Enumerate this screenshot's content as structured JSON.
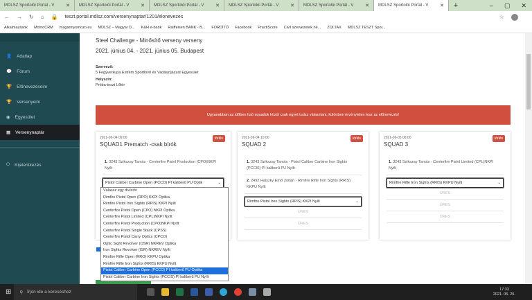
{
  "browser": {
    "tabs": [
      "MDLSZ Sportolói Portál - V",
      "MDLSZ Sportolói Portál - V",
      "MDLSZ Sportolói Portál - V",
      "MDLSZ Sportolói Portál - V",
      "MDLSZ Sportolói Portál - V",
      "MDLSZ Sportolói Portál - V"
    ],
    "url": "teszt.portal.mdlsz.com/versenynaptar/1201/elonevezes",
    "bookmarks": [
      "Alkalmazások",
      "MomoCRM",
      "magannyomozo.eu",
      "MDLSZ – Magyar D...",
      "K&H e-bank",
      "Raiffeisen BANK - B...",
      "FORDÍTÓ",
      "Facebook",
      "PractiScore",
      "Civil szervezetek né...",
      "ZOLTAX",
      "MDLSZ TESZT Spor..."
    ]
  },
  "sidebar": {
    "items": [
      "Adatlap",
      "Fórum",
      "Előnevezéseim",
      "Versenyeim",
      "Egyesület",
      "Versenynaptár"
    ],
    "logout": "Kijelentkezés"
  },
  "event": {
    "title": "Steel Challenge - Minősítő verseny verseny",
    "dates": "2021. június 04. - 2021. június 05. Budapest",
    "organizer_label": "Szervező:",
    "organizer": "5 Fegyverkupa Extrém Sportlövő és Vadászíjászat Egyesület",
    "venue_label": "Helyszín:",
    "venue": "Próba-teszt Lőtér"
  },
  "alert": "Ugyanabban az időben futó squadok közül csak egyet tudsz választani, különben érvénytelen lesz az előnevezés!",
  "squads": [
    {
      "date": "2021-06-04 09:00",
      "name": "SQUAD1 Prematch -csak bírók",
      "delete": "törlés",
      "entries": [
        {
          "num": "1.",
          "text": "3243 Szikszay Tamás - Centerfire Pistol Production (CPO)NKPI Nyílt"
        }
      ],
      "select": "Pistol Caliber Carbine Open (PCCO) PI kaliberű PU Optik",
      "empty": []
    },
    {
      "date": "2021-06-04 10:00",
      "name": "SQUAD 2",
      "delete": "törlés",
      "entries": [
        {
          "num": "1.",
          "text": "3243 Szikszay Tamás - Pistol Caliber Carbine Iron Sights (PCCIS) PI kaliberű PU Nyílt"
        },
        {
          "num": "2.",
          "text": "2492 Haiszky Ernő Zoltán - Rimfire Rifle Iron Sights (RRIS) KKPU Nyílt"
        }
      ],
      "select": "Rimfire Pistol Iron Sights (RPIS) KKPI Nyílt",
      "empty": [
        "ÜRES",
        "ÜRES"
      ]
    },
    {
      "date": "2021-06-05 09:00",
      "name": "SQUAD 3",
      "delete": "törlés",
      "entries": [
        {
          "num": "1.",
          "text": "3243 Szikszay Tamás - Centerfire Pistol Limited (CPL)NKPI Nyílt"
        }
      ],
      "select": "Rimfire Rifle Iron Sights (RRIS) KKPU Nyílt",
      "empty": [
        "ÜRES",
        "ÜRES",
        "ÜRES"
      ]
    }
  ],
  "dropdown": {
    "selected_index": 13,
    "options": [
      "Válassz egy divíziót",
      "Rimfire Pistol Open (RPO) KKPI Optika",
      "Rimfire Pistol Iron Sights (RPIS) KKPI Nyílt",
      "Centerfire Pistol Open (CPO) NKPI Optika",
      "Centerfire Pistol Limited (CPL)NKPI Nyílt",
      "Centerfire Pistol Production (CPO)NKPI Nyílt",
      "Centerfire Pistol Single Stack (CPSS)",
      "Centerfire Pistol Carry Optics (CPCO)",
      "Optic Sight Revolver (OSR) NKREV Optika",
      "Iron Sights Revolver (ISR) NKREV Nyílt",
      "Rimfire Rifle Open (RRO) KKPU Optika",
      "Rimfire Rifle Iron Sights (RRIS) KKPU Nyílt",
      "Pistol Caliber Carbine Open (PCCO) PI kaliberű PU Optika",
      "Pistol Caliber Carbine Iron Sights (PCCIS) PI kaliberű PU Nyílt"
    ]
  },
  "taskbar": {
    "search_placeholder": "Írjon ide a kereséshez",
    "time": "17:33",
    "date": "2021. 05. 25."
  }
}
